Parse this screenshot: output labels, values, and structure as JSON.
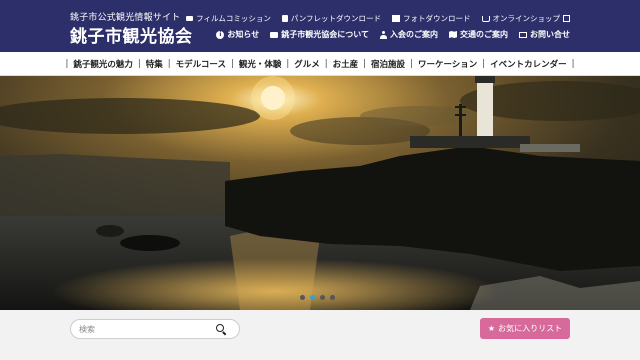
{
  "header": {
    "subtitle": "銚子市公式観光情報サイト",
    "title": "銚子市観光協会",
    "util_links": [
      {
        "icon": "video-camera-icon",
        "label": "フィルムコミッション"
      },
      {
        "icon": "book-icon",
        "label": "パンフレットダウンロード"
      },
      {
        "icon": "image-icon",
        "label": "フォトダウンロード"
      },
      {
        "icon": "cart-icon",
        "label": "オンラインショップ"
      }
    ],
    "main_links": [
      {
        "icon": "info-icon",
        "label": "お知らせ"
      },
      {
        "icon": "briefcase-icon",
        "label": "銚子市観光協会について"
      },
      {
        "icon": "user-icon",
        "label": "入会のご案内"
      },
      {
        "icon": "map-icon",
        "label": "交通のご案内"
      },
      {
        "icon": "mail-icon",
        "label": "お問い合せ"
      }
    ]
  },
  "nav": {
    "items": [
      "銚子観光の魅力",
      "特集",
      "モデルコース",
      "観光・体験",
      "グルメ",
      "お土産",
      "宿泊施設",
      "ワーケーション",
      "イベントカレンダー"
    ]
  },
  "hero": {
    "slide_count": 4,
    "active_slide": 2
  },
  "search": {
    "placeholder": "検索"
  },
  "favorites": {
    "label": "お気に入りリスト"
  },
  "colors": {
    "header_bg": "#2d2f6b",
    "favorite_button": "#d86a9b",
    "active_dot": "#37a1c7"
  }
}
